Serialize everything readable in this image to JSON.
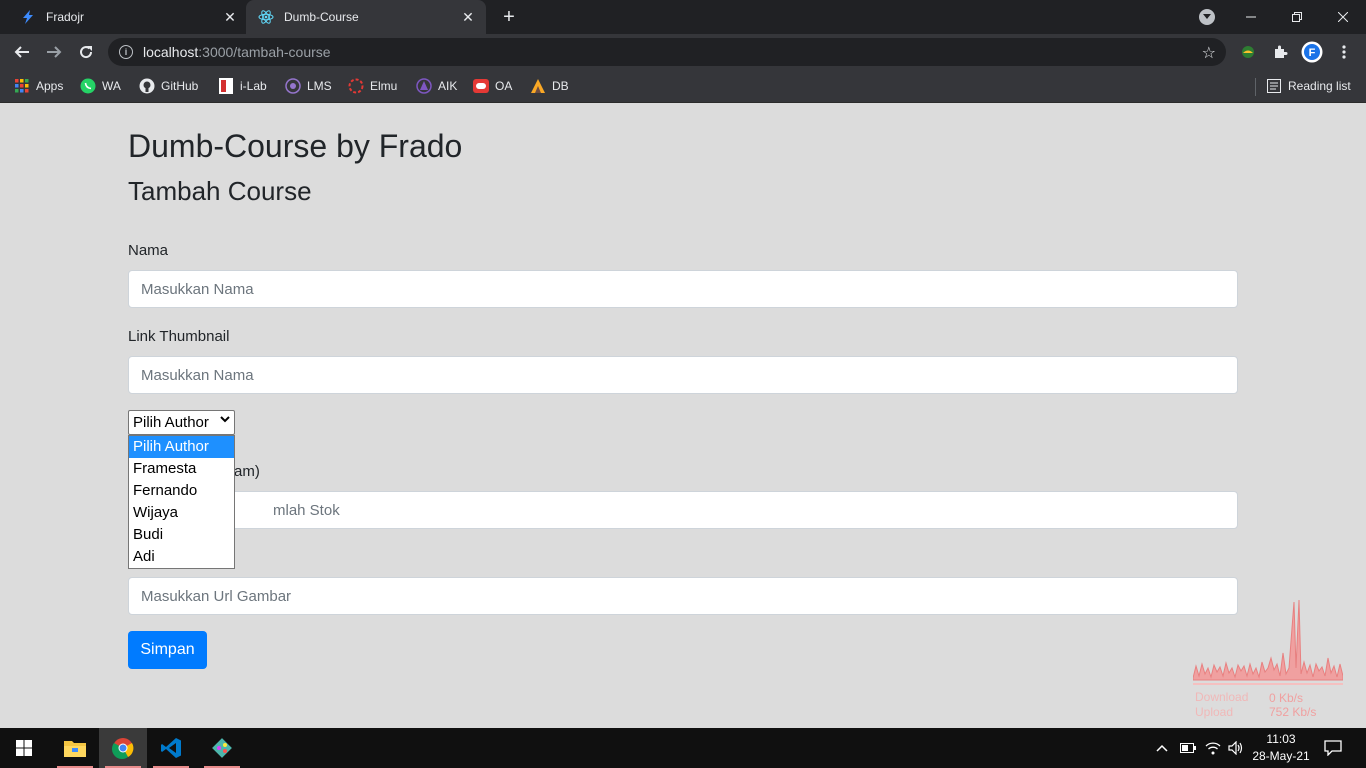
{
  "browser": {
    "tabs": [
      {
        "title": "Fradojr",
        "active": false
      },
      {
        "title": "Dumb-Course",
        "active": true
      }
    ],
    "url_host": "localhost",
    "url_rest": ":3000/tambah-course",
    "bookmarks": [
      {
        "label": "Apps",
        "icon": "apps-grid-icon"
      },
      {
        "label": "WA",
        "icon": "whatsapp-icon"
      },
      {
        "label": "GitHub",
        "icon": "github-icon"
      },
      {
        "label": "i-Lab",
        "icon": "ilab-icon"
      },
      {
        "label": "LMS",
        "icon": "lms-icon"
      },
      {
        "label": "Elmu",
        "icon": "elmu-icon"
      },
      {
        "label": "AIK",
        "icon": "aik-icon"
      },
      {
        "label": "OA",
        "icon": "oa-icon"
      },
      {
        "label": "DB",
        "icon": "db-icon"
      }
    ],
    "reading_list": "Reading list"
  },
  "page": {
    "title": "Dumb-Course by Frado",
    "subtitle": "Tambah Course",
    "fields": {
      "nama_label": "Nama",
      "nama_placeholder": "Masukkan Nama",
      "thumb_label": "Link Thumbnail",
      "thumb_placeholder": "Masukkan Nama",
      "hidden_label_tail": "am)",
      "stok_placeholder_tail": "mlah Stok",
      "gambar_placeholder": "Masukkan Url Gambar"
    },
    "author_select": {
      "selected": "Pilih Author",
      "options": [
        "Pilih Author",
        "Framesta",
        "Fernando",
        "Wijaya",
        "Budi",
        "Adi"
      ]
    },
    "submit_label": "Simpan"
  },
  "netmeter": {
    "download_label": "Download",
    "download_value": "0 Kb/s",
    "upload_label": "Upload",
    "upload_value": "752 Kb/s"
  },
  "taskbar": {
    "time": "11:03",
    "date": "28-May-21"
  },
  "colors": {
    "primary_button": "#007bff",
    "selected_option": "#1e90ff",
    "page_bg": "#dcdcdc"
  }
}
